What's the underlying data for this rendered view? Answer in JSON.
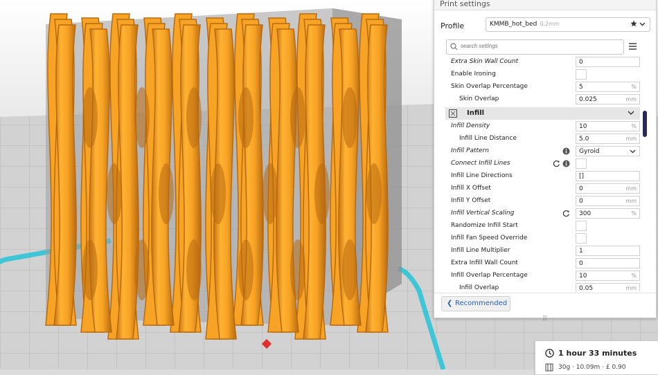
{
  "panel": {
    "title": "Print settings",
    "profile_label": "Profile",
    "profile_value": "KMMB_hot_bed",
    "profile_sub": "0.2mm",
    "search_placeholder": "search settings",
    "recommended_label": "Recommended",
    "drag_handle": "⠿"
  },
  "settings": [
    {
      "label": "Extra Skin Wall Count",
      "value": "0",
      "unit": "",
      "italic": true,
      "indent": 0,
      "type": "input"
    },
    {
      "label": "Enable Ironing",
      "value": "",
      "unit": "",
      "italic": false,
      "indent": 0,
      "type": "checkbox"
    },
    {
      "label": "Skin Overlap Percentage",
      "value": "5",
      "unit": "%",
      "italic": false,
      "indent": 0,
      "type": "input"
    },
    {
      "label": "Skin Overlap",
      "value": "0.025",
      "unit": "mm",
      "italic": false,
      "indent": 1,
      "type": "input"
    },
    {
      "label": "Infill",
      "type": "category"
    },
    {
      "label": "Infill Density",
      "value": "10",
      "unit": "%",
      "italic": true,
      "indent": 0,
      "type": "input"
    },
    {
      "label": "Infill Line Distance",
      "value": "5.0",
      "unit": "mm",
      "italic": false,
      "indent": 1,
      "type": "input"
    },
    {
      "label": "Infill Pattern",
      "value": "Gyroid",
      "unit": "",
      "italic": true,
      "indent": 0,
      "type": "select",
      "icons": [
        "info"
      ]
    },
    {
      "label": "Connect Infill Lines",
      "value": "",
      "unit": "",
      "italic": true,
      "indent": 0,
      "type": "checkbox",
      "icons": [
        "reset",
        "info"
      ]
    },
    {
      "label": "Infill Line Directions",
      "value": "[]",
      "unit": "",
      "italic": false,
      "indent": 0,
      "type": "input"
    },
    {
      "label": "Infill X Offset",
      "value": "0",
      "unit": "mm",
      "italic": false,
      "indent": 0,
      "type": "input"
    },
    {
      "label": "Infill Y Offset",
      "value": "0",
      "unit": "mm",
      "italic": false,
      "indent": 0,
      "type": "input"
    },
    {
      "label": "Infill Vertical Scaling",
      "value": "300",
      "unit": "%",
      "italic": true,
      "indent": 0,
      "type": "input",
      "icons": [
        "reset"
      ]
    },
    {
      "label": "Randomize Infill Start",
      "value": "",
      "unit": "",
      "italic": false,
      "indent": 0,
      "type": "checkbox"
    },
    {
      "label": "Infill Fan Speed Override",
      "value": "",
      "unit": "",
      "italic": false,
      "indent": 0,
      "type": "checkbox"
    },
    {
      "label": "Infill Line Multiplier",
      "value": "1",
      "unit": "",
      "italic": false,
      "indent": 0,
      "type": "input"
    },
    {
      "label": "Extra Infill Wall Count",
      "value": "0",
      "unit": "",
      "italic": false,
      "indent": 0,
      "type": "input"
    },
    {
      "label": "Infill Overlap Percentage",
      "value": "10",
      "unit": "%",
      "italic": false,
      "indent": 0,
      "type": "input"
    },
    {
      "label": "Infill Overlap",
      "value": "0.05",
      "unit": "mm",
      "italic": false,
      "indent": 1,
      "type": "input"
    }
  ],
  "estimate": {
    "time": "1 hour 33 minutes",
    "material": "30g · 10.09m · £ 0.90"
  },
  "colors": {
    "model": "#f7a325",
    "model_shadow": "#b86a10",
    "plate_outline": "#3fc6d6",
    "accent": "#2a5db0"
  }
}
